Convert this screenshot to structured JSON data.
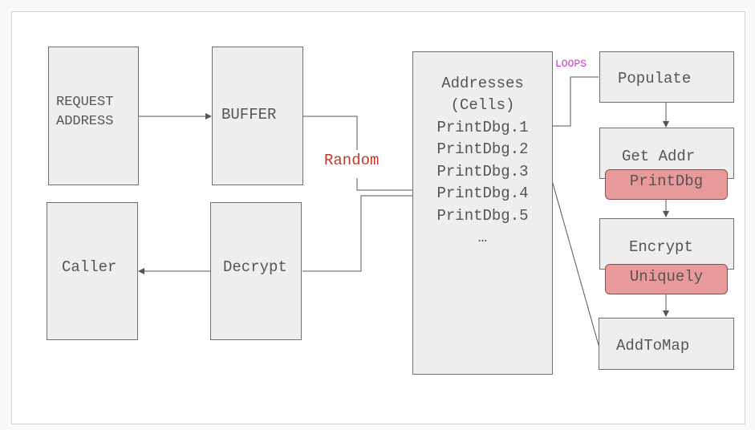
{
  "diagram": {
    "nodes": {
      "request_address": "REQUEST\nADDRESS",
      "buffer": "BUFFER",
      "caller": "Caller",
      "decrypt": "Decrypt",
      "addresses_title": "Addresses",
      "addresses_subtitle": "(Cells)",
      "populate": "Populate",
      "get_addr": "Get Addr",
      "encrypt": "Encrypt",
      "add_to_map": "AddToMap"
    },
    "address_cells": [
      "PrintDbg.1",
      "PrintDbg.2",
      "PrintDbg.3",
      "PrintDbg.4",
      "PrintDbg.5",
      "…"
    ],
    "tags": {
      "print_dbg": "PrintDbg",
      "uniquely": "Uniquely"
    },
    "edge_labels": {
      "random": "Random",
      "loops": "LOOPS"
    },
    "colors": {
      "box_fill": "#eeeeee",
      "box_border": "#707070",
      "tag_fill": "#e89a9a",
      "random_label": "#c0392b",
      "loops_label": "#cc33cc"
    }
  }
}
